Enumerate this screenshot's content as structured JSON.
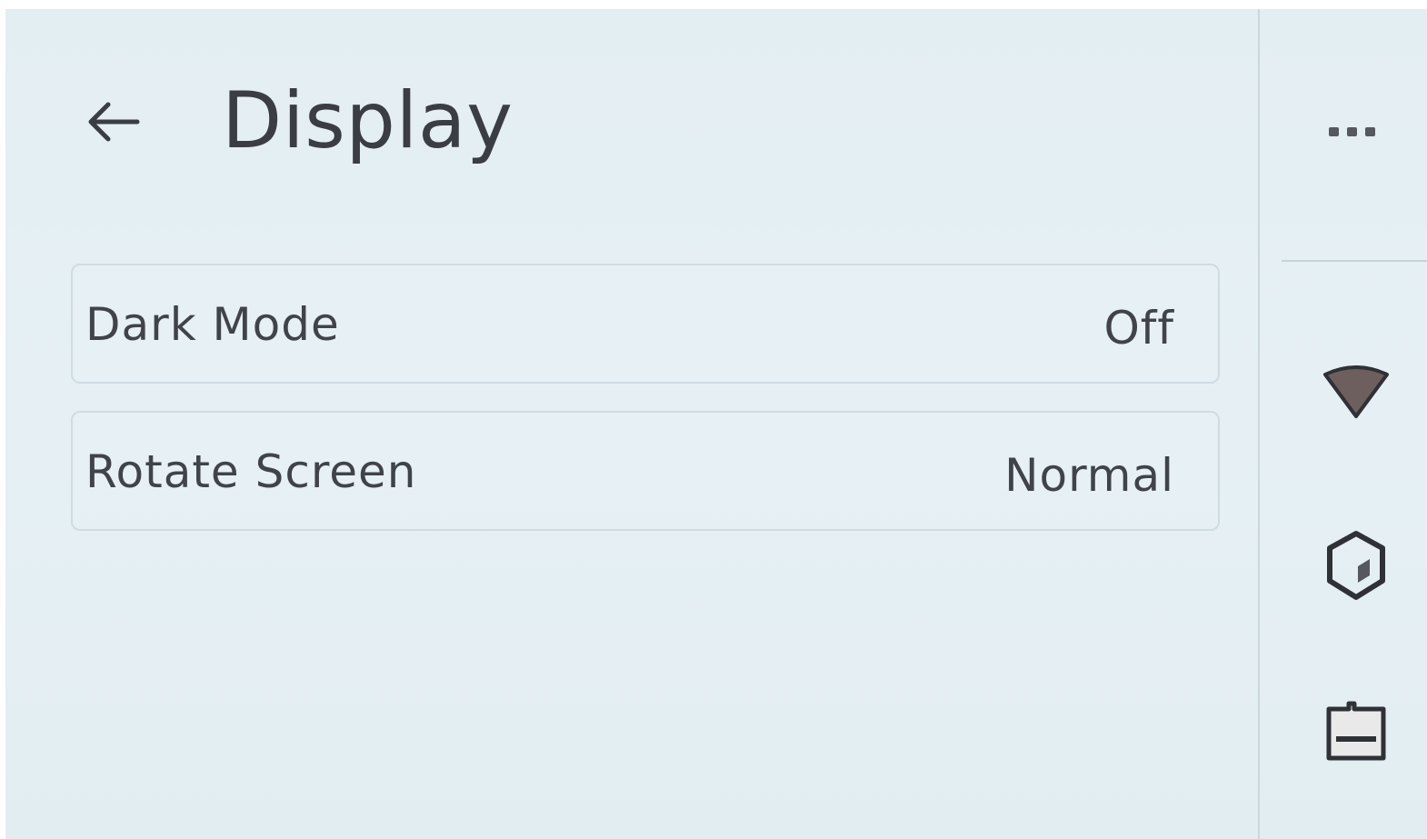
{
  "header": {
    "title": "Display"
  },
  "settings": {
    "items": [
      {
        "label": "Dark Mode",
        "value": "Off"
      },
      {
        "label": "Rotate Screen",
        "value": "Normal"
      }
    ]
  },
  "rail": {
    "icons": [
      "more-icon",
      "wifi-icon",
      "cube-icon",
      "storage-icon"
    ]
  },
  "colors": {
    "background": "#e4eff3",
    "text": "#3a3d44",
    "border": "#cfdce3"
  }
}
